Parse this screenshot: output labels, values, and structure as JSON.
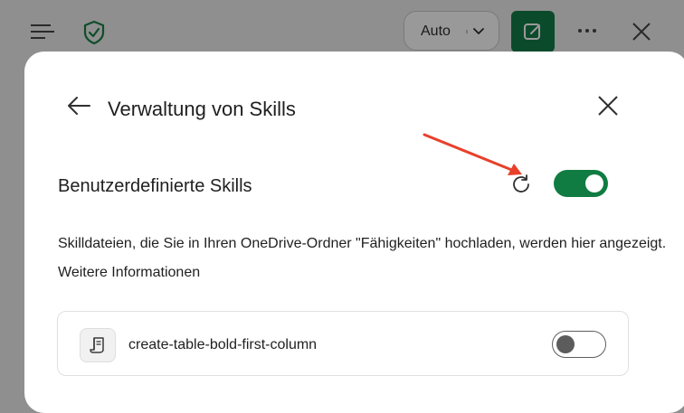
{
  "toolbar": {
    "mode_select_value": "Auto",
    "icons": [
      "menu-icon",
      "shield-check-icon",
      "chevron-down-icon",
      "compose-icon",
      "more-icon",
      "close-icon"
    ]
  },
  "dialog": {
    "title": "Verwaltung von Skills",
    "section_label": "Benutzerdefinierte Skills",
    "section_toggle_on": true,
    "description": "Skilldateien, die Sie in Ihren OneDrive-Ordner \"Fähigkeiten\" hochladen, werden hier angezeigt.",
    "more_info_label": "Weitere Informationen",
    "skills": [
      {
        "name": "create-table-bold-first-column",
        "enabled": false,
        "icon": "scroll-icon"
      }
    ]
  },
  "colors": {
    "accent_green": "#107c41",
    "dark_green": "#0c4a2c",
    "annotation_arrow": "#e8402a",
    "overlay": "#8f8f8f"
  }
}
